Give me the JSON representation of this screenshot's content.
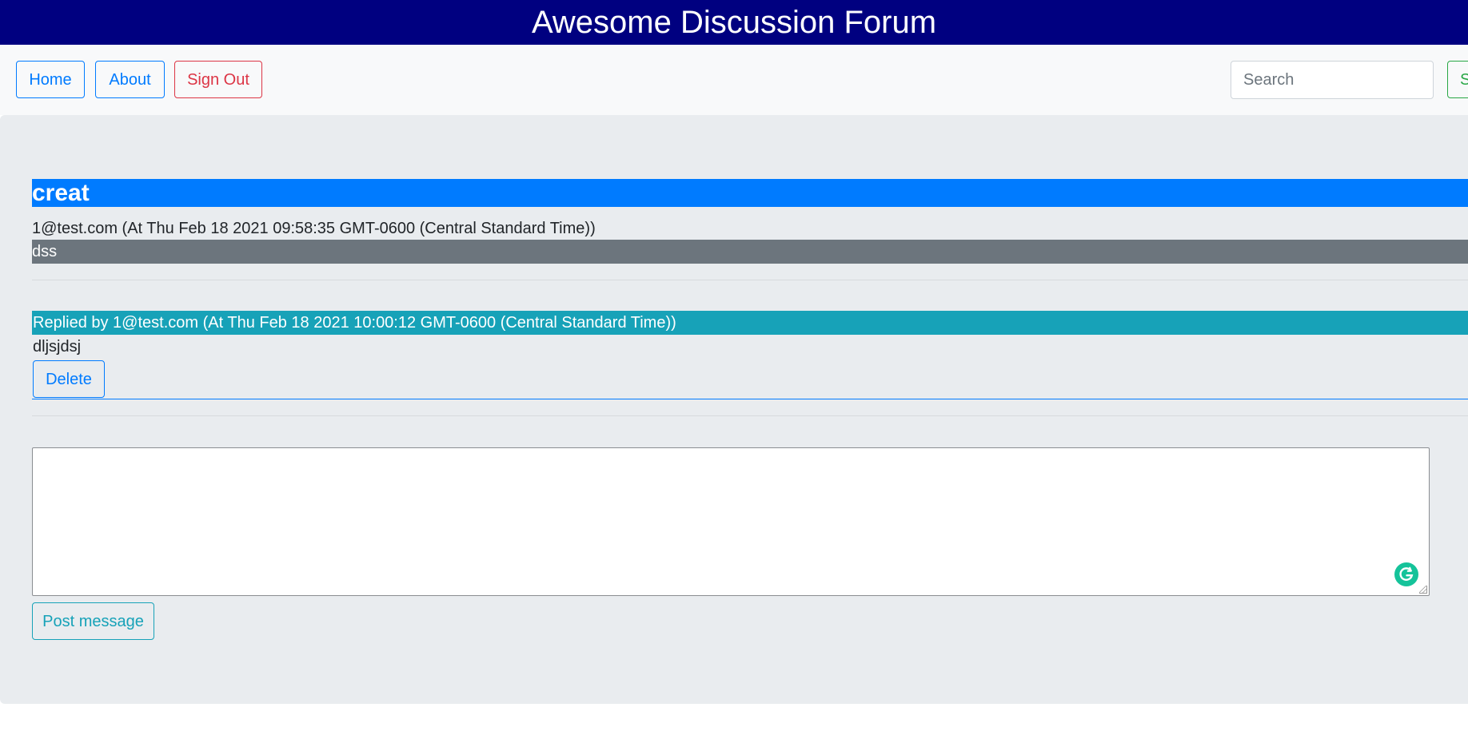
{
  "header": {
    "title": "Awesome Discussion Forum"
  },
  "nav": {
    "home_label": "Home",
    "about_label": "About",
    "signout_label": "Sign Out",
    "search_placeholder": "Search",
    "search_button_label": "Search"
  },
  "thread": {
    "title": "creat",
    "meta": "1@test.com (At Thu Feb 18 2021 09:58:35 GMT-0600 (Central Standard Time))",
    "body": "dss"
  },
  "replies": [
    {
      "header": "Replied by 1@test.com (At Thu Feb 18 2021 10:00:12 GMT-0600 (Central Standard Time))",
      "body": "dljsjdsj",
      "delete_label": "Delete"
    }
  ],
  "composer": {
    "value": "",
    "post_label": "Post message"
  },
  "icons": {
    "editor_assistant": "grammarly-g-icon"
  },
  "colors": {
    "header_bg": "#000080",
    "primary": "#007bff",
    "danger": "#dc3545",
    "success": "#28a745",
    "info": "#17a2b8",
    "secondary": "#6c757d",
    "grammarly": "#15c39a"
  }
}
